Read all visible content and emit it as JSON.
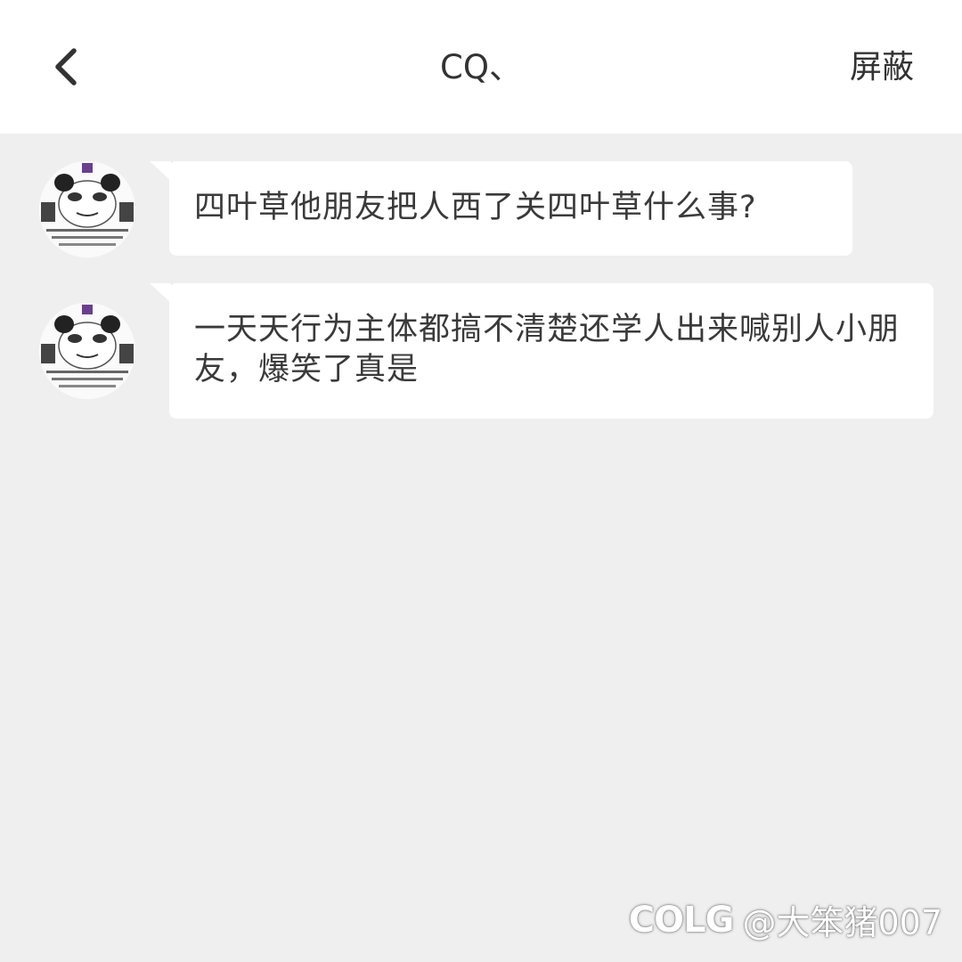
{
  "header": {
    "title": "CQ、",
    "block_label": "屏蔽",
    "back_icon": "chevron-left-icon"
  },
  "messages": [
    {
      "text": "四叶草他朋友把人西了关四叶草什么事?",
      "sender_avatar": "panda-meme-avatar"
    },
    {
      "text": "一天天行为主体都搞不清楚还学人出来喊别人小朋友，爆笑了真是",
      "sender_avatar": "panda-meme-avatar"
    }
  ],
  "watermark": {
    "logo": "COLG",
    "user": "@大笨猪007"
  },
  "colors": {
    "background": "#efefef",
    "header": "#ffffff",
    "bubble": "#ffffff",
    "text": "#333333"
  }
}
